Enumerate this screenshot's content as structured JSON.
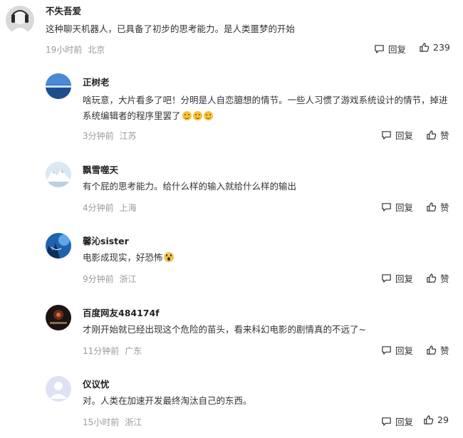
{
  "actions": {
    "reply_label": "回复",
    "like_label": "赞"
  },
  "comments": [
    {
      "user": "不失吾爱",
      "text": "这种聊天机器人，已具备了初步的思考能力。是人类噩梦的开始",
      "time": "19小时前",
      "location": "北京",
      "likes": "239"
    },
    {
      "user": "正树老",
      "text": "啥玩意，大片看多了吧！分明是人自恋臆想的情节。一些人习惯了游戏系统设计的情节，掉进系统编辑者的程序里罢了",
      "time": "3分钟前",
      "location": "江苏",
      "likes": "赞"
    },
    {
      "user": "飘雪噬天",
      "text": "有个屁的思考能力。给什么样的输入就给什么样的输出",
      "time": "4分钟前",
      "location": "上海",
      "likes": "赞"
    },
    {
      "user": "馨沁sister",
      "text": "电影成现实，好恐怖",
      "time": "9分钟前",
      "location": "浙江",
      "likes": "赞"
    },
    {
      "user": "百度网友484174f",
      "text": "才刚开始就已经出现这个危险的苗头，看来科幻电影的剧情真的不远了~",
      "time": "11分钟前",
      "location": "广东",
      "likes": "赞"
    },
    {
      "user": "仪议忧",
      "text": "对。人类在加速开发最终淘汰自己的东西。",
      "time": "15小时前",
      "location": "浙江",
      "likes": "29"
    }
  ],
  "colors": {
    "text": "#333333",
    "meta": "#9a9a9a",
    "name": "#222222"
  }
}
